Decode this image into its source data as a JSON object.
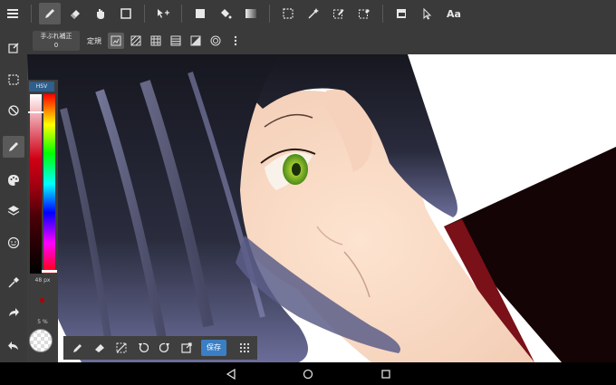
{
  "toolbar": {
    "icons": [
      "menu-icon",
      "pen-icon",
      "eraser-icon",
      "hand-icon",
      "square-icon",
      "move-icon",
      "fill-square-icon",
      "bucket-icon",
      "gradient-icon",
      "select-rect-icon",
      "magic-wand-icon",
      "select-pen-icon",
      "select-eraser-icon",
      "layer-icon",
      "cursor-icon"
    ],
    "text_tool_label": "Aa"
  },
  "subbar": {
    "stabilizer_label": "手ぶれ補正",
    "stabilizer_value": "0",
    "ruler_label": "定規"
  },
  "color_panel": {
    "mode_tab": "HSV",
    "brush_size": "48 px",
    "opacity": "5 %",
    "colors": {
      "selected": "#b40000"
    }
  },
  "bottom_toolbar": {
    "save_label": "保存"
  },
  "colors": {
    "toolbar_bg": "#3a3a3a",
    "save_button": "#3a7fc4",
    "canvas_bg": "#ffffff"
  }
}
